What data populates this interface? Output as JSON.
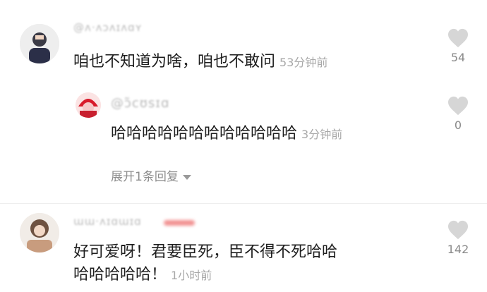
{
  "comments": [
    {
      "text": "咱也不知道为啥，咱也不敢问",
      "time": "53分钟前",
      "likes": "54",
      "reply": {
        "username": "@ɔ̃cʊsɪɑ",
        "text": "哈哈哈哈哈哈哈哈哈哈哈哈",
        "time": "3分钟前",
        "likes": "0"
      },
      "expand_label": "展开1条回复"
    },
    {
      "text_line1": "好可爱呀！君要臣死，臣不得不死哈哈",
      "text_line2": "哈哈哈哈哈！",
      "time": "1小时前",
      "likes": "142"
    }
  ],
  "colors": {
    "heart": "#d6d6d6",
    "accent_blur": "#e94b4b"
  }
}
